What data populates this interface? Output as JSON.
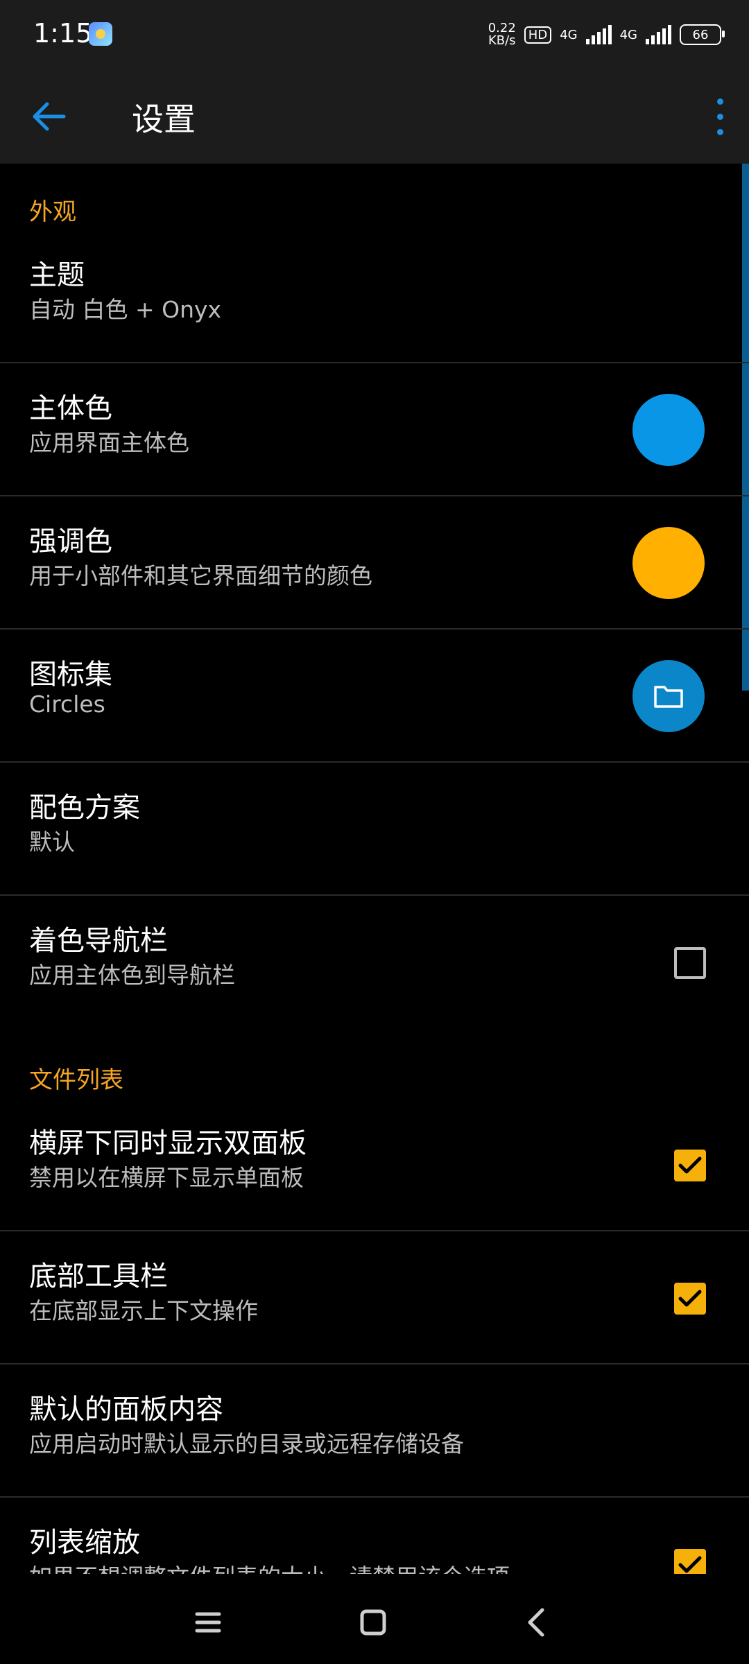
{
  "status_bar": {
    "time": "1:15",
    "speed_value": "0.22",
    "speed_unit": "KB/s",
    "hd_label": "HD",
    "network_1": "4G",
    "network_2": "4G",
    "battery": "66"
  },
  "app_bar": {
    "title": "设置"
  },
  "sections": [
    {
      "header": "外观",
      "items": [
        {
          "title": "主题",
          "subtitle": "自动 白色 + Onyx"
        },
        {
          "title": "主体色",
          "subtitle": "应用界面主体色",
          "color": "#0a96e6"
        },
        {
          "title": "强调色",
          "subtitle": "用于小部件和其它界面细节的颜色",
          "color": "#ffb000"
        },
        {
          "title": "图标集",
          "subtitle": "Circles",
          "icon": "folder-icon"
        },
        {
          "title": "配色方案",
          "subtitle": "默认"
        },
        {
          "title": "着色导航栏",
          "subtitle": "应用主体色到导航栏",
          "checked": false
        }
      ]
    },
    {
      "header": "文件列表",
      "items": [
        {
          "title": "横屏下同时显示双面板",
          "subtitle": "禁用以在横屏下显示单面板",
          "checked": true
        },
        {
          "title": "底部工具栏",
          "subtitle": "在底部显示上下文操作",
          "checked": true
        },
        {
          "title": "默认的面板内容",
          "subtitle": "应用启动时默认显示的目录或远程存储设备"
        },
        {
          "title": "列表缩放",
          "subtitle": "如果不想调整文件列表的大小，请禁用该个选项",
          "checked": true
        }
      ]
    }
  ],
  "colors": {
    "accent_header": "#f5a623",
    "primary": "#0a96e6",
    "checkbox_on": "#f5b00a"
  },
  "nav": {
    "menu_icon": "menu-icon",
    "home_icon": "home-icon",
    "back_icon": "back-icon"
  }
}
